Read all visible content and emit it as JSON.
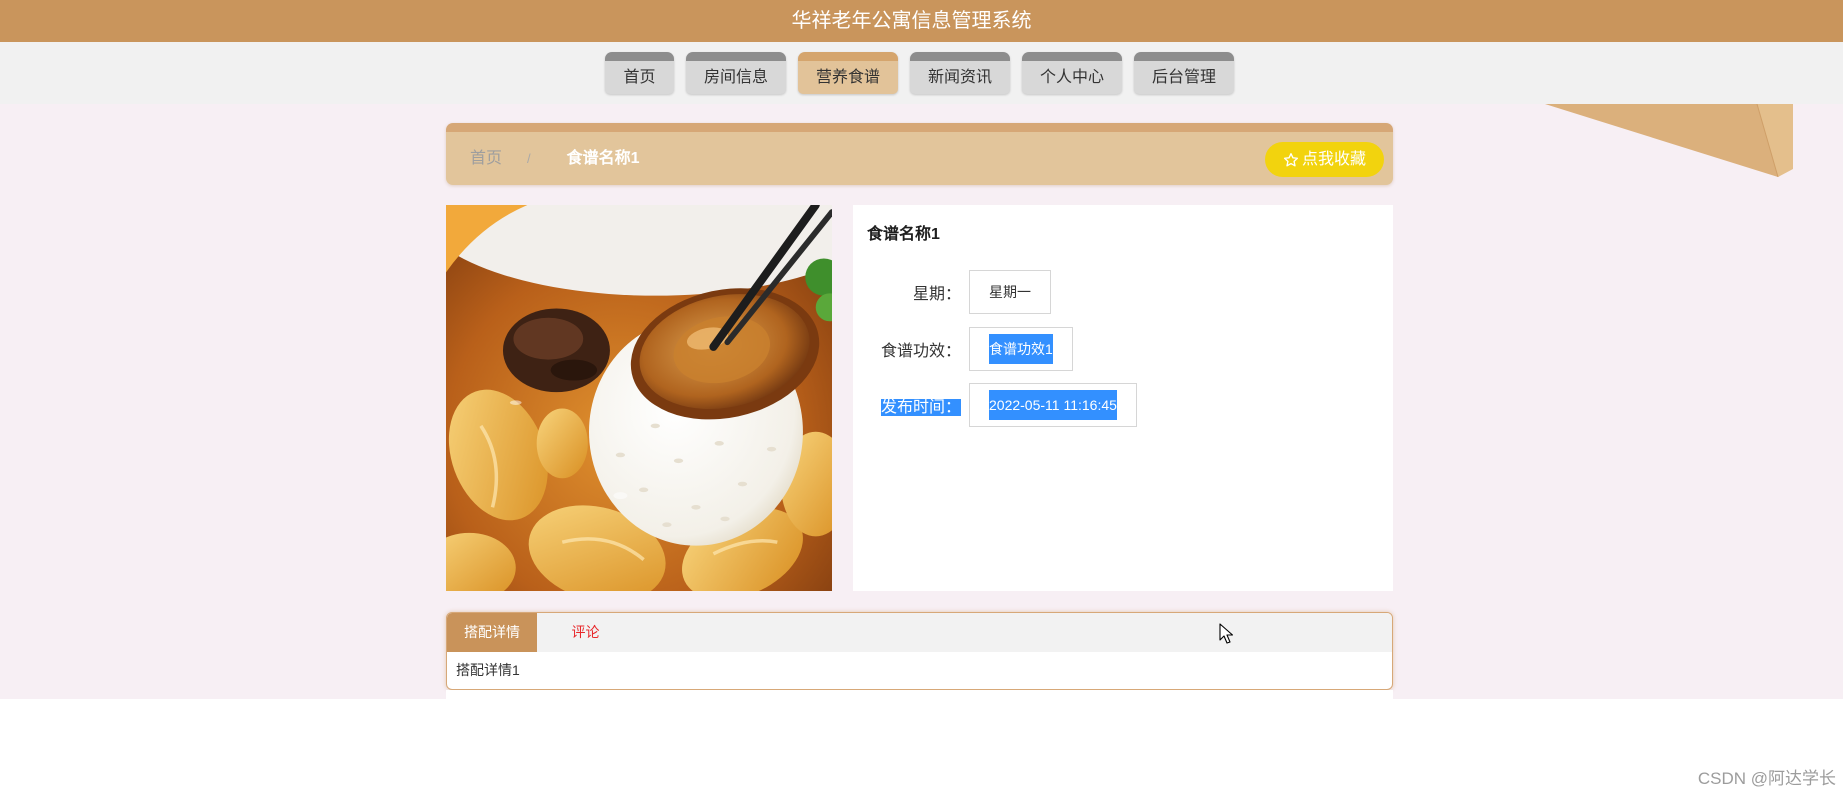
{
  "header": {
    "title": "华祥老年公寓信息管理系统"
  },
  "nav": {
    "items": [
      {
        "label": "首页",
        "active": false
      },
      {
        "label": "房间信息",
        "active": false
      },
      {
        "label": "营养食谱",
        "active": true
      },
      {
        "label": "新闻资讯",
        "active": false
      },
      {
        "label": "个人中心",
        "active": false
      },
      {
        "label": "后台管理",
        "active": false
      }
    ]
  },
  "breadcrumb": {
    "home": "首页",
    "separator": "/",
    "current": "食谱名称1"
  },
  "favorite_button": {
    "label": "点我收藏",
    "icon": "star-outline-icon"
  },
  "recipe": {
    "title": "食谱名称1",
    "fields": [
      {
        "label": "星期：",
        "value": "星期一"
      },
      {
        "label": "食谱功效：",
        "value": "食谱功效1"
      },
      {
        "label": "发布时间：",
        "value": "2022-05-11 11:16:45"
      }
    ]
  },
  "tabs": {
    "items": [
      {
        "label": "搭配详情",
        "active": true
      },
      {
        "label": "评论",
        "active": false
      }
    ],
    "content": "搭配详情1"
  },
  "watermark": "CSDN @阿达学长",
  "colors": {
    "header": "#c9955c",
    "nav_active": "#e2c399",
    "breadcrumb_bar": "#e2c59b",
    "favorite_button": "#f2d30e",
    "tab_active": "#c9935a",
    "comment_tab_text": "#e8282b",
    "selection": "#3390ff",
    "page_background": "#f7eff4"
  }
}
